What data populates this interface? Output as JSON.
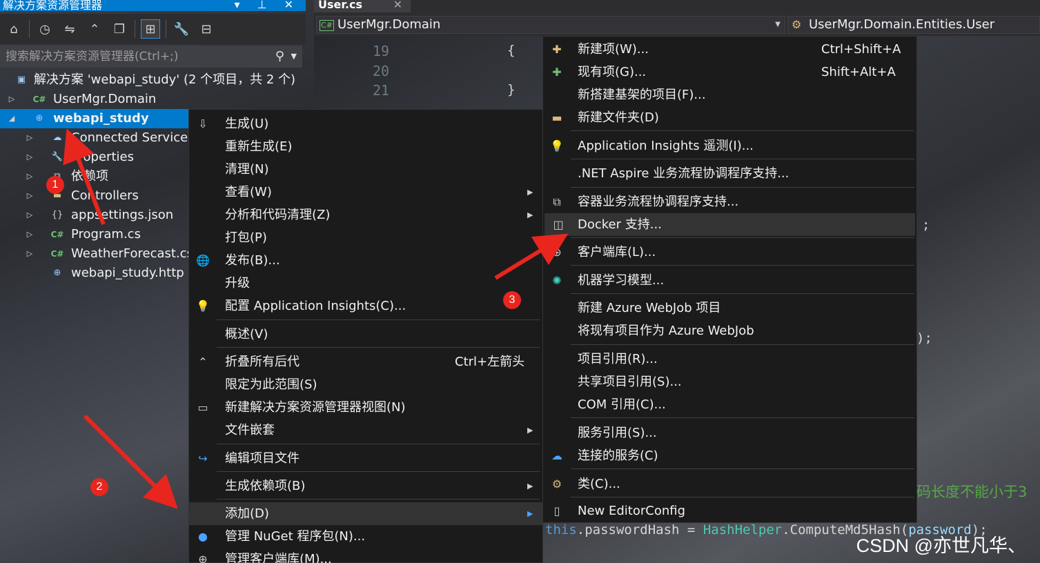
{
  "solution_explorer": {
    "title": "解决方案资源管理器",
    "title_controls": "▾ ⊥ ✕",
    "search_placeholder": "搜索解决方案资源管理器(Ctrl+;)",
    "solution_label": "解决方案 'webapi_study' (2 个项目，共 2 个)",
    "items": [
      {
        "label": "UserMgr.Domain",
        "icon": "csharp-project-icon"
      },
      {
        "label": "webapi_study",
        "icon": "web-project-icon"
      },
      {
        "label": "Connected Services",
        "icon": "connected-services-icon"
      },
      {
        "label": "Properties",
        "icon": "properties-icon"
      },
      {
        "label": "依赖项",
        "icon": "dependencies-icon"
      },
      {
        "label": "Controllers",
        "icon": "folder-icon"
      },
      {
        "label": "appsettings.json",
        "icon": "json-file-icon"
      },
      {
        "label": "Program.cs",
        "icon": "csharp-file-icon"
      },
      {
        "label": "WeatherForecast.cs",
        "icon": "csharp-file-icon"
      },
      {
        "label": "webapi_study.http",
        "icon": "http-file-icon"
      }
    ]
  },
  "editor": {
    "tab_label": "User.cs",
    "nav_project": "UserMgr.Domain",
    "nav_class": "UserMgr.Domain.Entities.User",
    "line_numbers": [
      "19",
      "20",
      "21"
    ],
    "code_fragments": {
      "brace_open": "{",
      "brace_close": "}",
      "semicolon": ";",
      "paren_semicolon": ");",
      "comment_tail": "码长度不能小于3",
      "assign_this": "this",
      "assign_prop": ".passwordHash",
      "assign_eq": " = ",
      "assign_class": "HashHelper",
      "assign_method": ".ComputeMd5Hash(",
      "assign_arg": "password",
      "assign_end": ");"
    }
  },
  "context_menu": {
    "items": [
      {
        "label": "生成(U)",
        "icon": "build-icon"
      },
      {
        "label": "重新生成(E)"
      },
      {
        "label": "清理(N)"
      },
      {
        "label": "查看(W)",
        "submenu": true
      },
      {
        "label": "分析和代码清理(Z)",
        "submenu": true
      },
      {
        "label": "打包(P)"
      },
      {
        "label": "发布(B)...",
        "icon": "publish-globe-icon"
      },
      {
        "label": "升级"
      },
      {
        "label": "配置 Application Insights(C)...",
        "icon": "app-insights-icon"
      },
      {
        "label": "概述(V)"
      },
      {
        "label": "折叠所有后代",
        "shortcut": "Ctrl+左箭头",
        "icon": "collapse-icon"
      },
      {
        "label": "限定为此范围(S)"
      },
      {
        "label": "新建解决方案资源管理器视图(N)",
        "icon": "new-view-icon"
      },
      {
        "label": "文件嵌套",
        "submenu": true
      },
      {
        "label": "编辑项目文件",
        "icon": "edit-project-icon"
      },
      {
        "label": "生成依赖项(B)",
        "submenu": true
      },
      {
        "label": "添加(D)",
        "submenu": true
      },
      {
        "label": "管理 NuGet 程序包(N)...",
        "icon": "nuget-icon"
      },
      {
        "label": "管理客户端库(M)..."
      }
    ]
  },
  "add_submenu": {
    "items": [
      {
        "label": "新建项(W)...",
        "shortcut": "Ctrl+Shift+A",
        "icon": "new-item-icon"
      },
      {
        "label": "现有项(G)...",
        "shortcut": "Shift+Alt+A",
        "icon": "existing-item-icon"
      },
      {
        "label": "新搭建基架的项目(F)..."
      },
      {
        "label": "新建文件夹(D)",
        "icon": "new-folder-icon"
      },
      {
        "label": "Application Insights 遥测(I)...",
        "icon": "app-insights-icon"
      },
      {
        "label": ".NET Aspire 业务流程协调程序支持..."
      },
      {
        "label": "容器业务流程协调程序支持...",
        "icon": "container-orchestration-icon"
      },
      {
        "label": "Docker 支持...",
        "icon": "docker-icon"
      },
      {
        "label": "客户端库(L)...",
        "icon": "client-library-icon"
      },
      {
        "label": "机器学习模型...",
        "icon": "ml-model-icon"
      },
      {
        "label": "新建 Azure WebJob 项目"
      },
      {
        "label": "将现有项目作为 Azure WebJob"
      },
      {
        "label": "项目引用(R)..."
      },
      {
        "label": "共享项目引用(S)..."
      },
      {
        "label": "COM 引用(C)..."
      },
      {
        "label": "服务引用(S)..."
      },
      {
        "label": "连接的服务(C)",
        "icon": "connected-services-icon"
      },
      {
        "label": "类(C)...",
        "icon": "class-icon"
      },
      {
        "label": "New EditorConfig",
        "icon": "editorconfig-icon"
      }
    ]
  },
  "annotations": {
    "badge_1": "1",
    "badge_2": "2",
    "badge_3": "3",
    "arrow_color": "#e8261e"
  },
  "watermark": "CSDN @亦世凡华、"
}
